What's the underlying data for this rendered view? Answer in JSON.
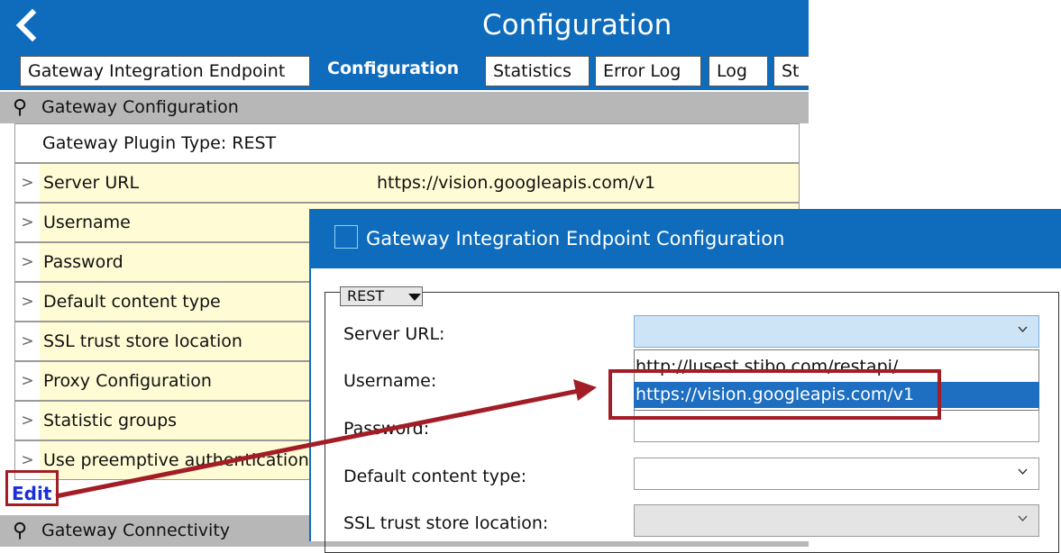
{
  "window": {
    "title": "Configuration"
  },
  "tabs": [
    {
      "label": "Gateway Integration Endpoint",
      "active": false
    },
    {
      "label": "Configuration",
      "active": true
    },
    {
      "label": "Statistics",
      "active": false
    },
    {
      "label": "Error Log",
      "active": false
    },
    {
      "label": "Log",
      "active": false
    },
    {
      "label": "St",
      "active": false
    }
  ],
  "section_gateway_configuration": {
    "label": "Gateway Configuration",
    "plugin_type": "Gateway Plugin Type: REST",
    "properties": [
      {
        "name": "Server URL",
        "value": "https://vision.googleapis.com/v1"
      },
      {
        "name": "Username",
        "value": ""
      },
      {
        "name": "Password",
        "value": ""
      },
      {
        "name": "Default content type",
        "value": ""
      },
      {
        "name": "SSL trust store location",
        "value": ""
      },
      {
        "name": "Proxy Configuration",
        "value": ""
      },
      {
        "name": "Statistic groups",
        "value": ""
      },
      {
        "name": "Use preemptive authentication",
        "value": ""
      }
    ],
    "edit_label": "Edit"
  },
  "section_gateway_connectivity": {
    "label": "Gateway Connectivity"
  },
  "dialog": {
    "title": "Gateway Integration Endpoint Configuration",
    "plugin_selector": "REST",
    "fields": [
      {
        "label": "Server URL:",
        "value": "",
        "state": "open"
      },
      {
        "label": "Username:",
        "value": ""
      },
      {
        "label": "Password:",
        "value": ""
      },
      {
        "label": "Default content type:",
        "value": ""
      },
      {
        "label": "SSL trust store location:",
        "value": "",
        "state": "disabled"
      }
    ],
    "server_url_options": [
      {
        "label": "http://lusest.stibo.com/restapi/",
        "selected": false
      },
      {
        "label": "https://vision.googleapis.com/v1",
        "selected": true
      }
    ]
  },
  "colors": {
    "header_blue": "#0f6cbd",
    "highlight_red": "#a21d26",
    "property_yellow": "#fffbd4",
    "section_gray": "#b7b7b7",
    "selection_blue": "#1e6fc1"
  },
  "icons": [
    "back-chevron-icon",
    "pin-icon",
    "expand-arrow-icon",
    "dialog-window-icon",
    "dropdown-caret-icon",
    "chevron-down-icon"
  ]
}
